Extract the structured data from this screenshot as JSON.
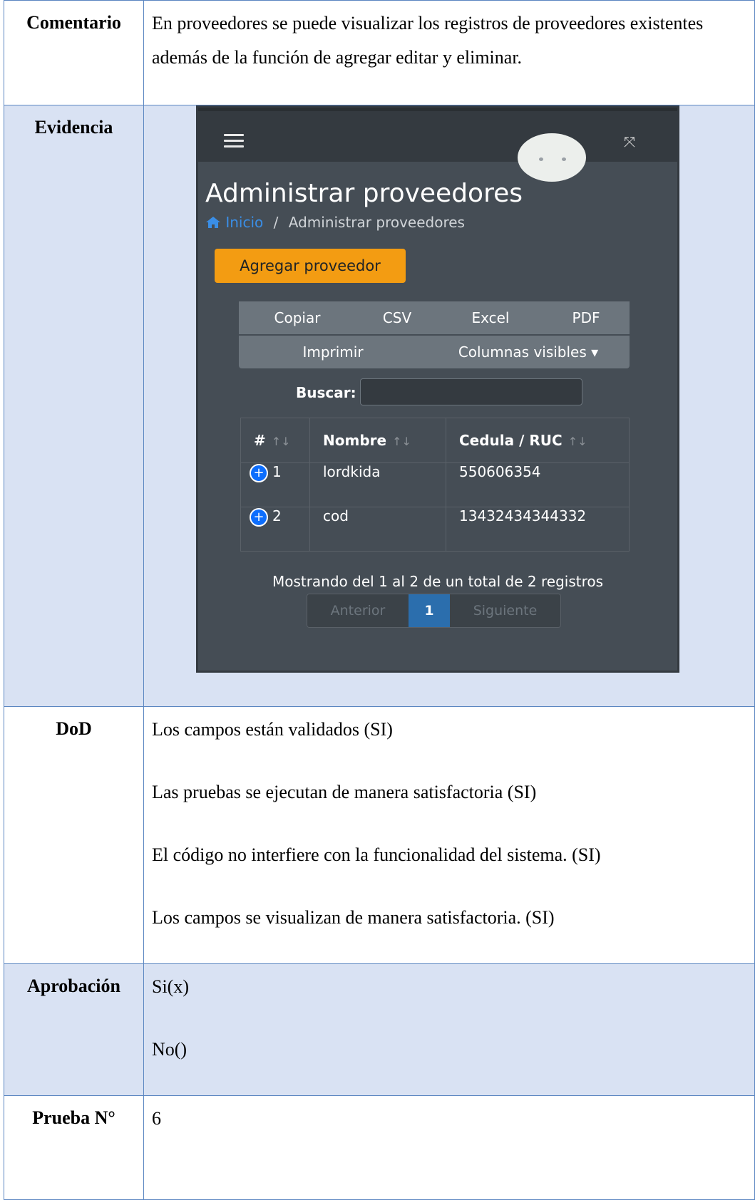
{
  "rows": {
    "comentario": {
      "label": "Comentario",
      "text": "En proveedores se puede visualizar los registros de proveedores existentes además de la función de agregar editar y eliminar."
    },
    "evidencia": {
      "label": "Evidencia"
    },
    "dod": {
      "label": "DoD",
      "items": [
        "Los campos están validados (SI)",
        "Las pruebas se ejecutan de manera satisfactoria (SI)",
        "El código no interfiere con la funcionalidad del sistema. (SI)",
        "Los campos se visualizan de manera satisfactoria. (SI)"
      ]
    },
    "aprobacion": {
      "label": "Aprobación",
      "yes": "Si(x)",
      "no": "No()"
    },
    "prueba": {
      "label": "Prueba N°",
      "value": "6"
    }
  },
  "app": {
    "page_title": "Administrar proveedores",
    "breadcrumb": {
      "home": "Inicio",
      "separator": "/",
      "current": "Administrar proveedores"
    },
    "add_button": "Agregar proveedor",
    "export_buttons": [
      "Copiar",
      "CSV",
      "Excel",
      "PDF"
    ],
    "print_button": "Imprimir",
    "columns_button": "Columnas visibles ▾",
    "search_label": "Buscar:",
    "table": {
      "headers": [
        "#",
        "Nombre",
        "Cedula / RUC"
      ],
      "rows": [
        {
          "n": "1",
          "nombre": "lordkida",
          "ruc": "550606354"
        },
        {
          "n": "2",
          "nombre": "cod",
          "ruc": "13432434344332"
        }
      ]
    },
    "info": "Mostrando del 1 al 2 de un total de 2 registros",
    "pagination": {
      "prev": "Anterior",
      "current": "1",
      "next": "Siguiente"
    },
    "colors": {
      "accent": "#f39c12",
      "link": "#3a8ee6",
      "panel": "#454d55"
    }
  }
}
